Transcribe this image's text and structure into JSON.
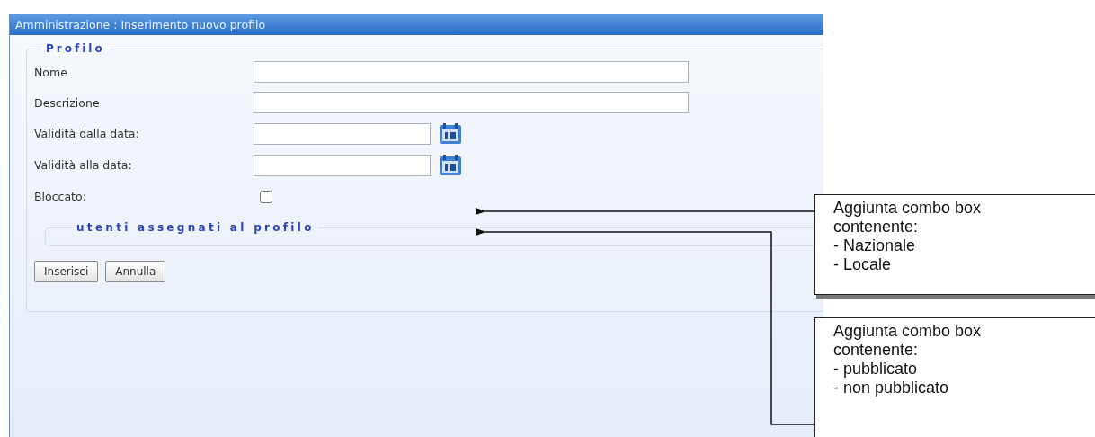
{
  "window": {
    "title": "Amministrazione : Inserimento nuovo profilo"
  },
  "profile": {
    "legend": "Profilo",
    "fields": [
      {
        "kind": "text",
        "label": "Nome"
      },
      {
        "kind": "text",
        "label": "Descrizione"
      },
      {
        "kind": "date",
        "label": "Validità dalla data:"
      },
      {
        "kind": "date",
        "label": "Validità alla data:"
      },
      {
        "kind": "checkbox",
        "label": "Bloccato:",
        "checked": false
      }
    ],
    "users_section": {
      "legend": "utenti assegnati al profilo"
    },
    "buttons": [
      "Inserisci",
      "Annulla"
    ]
  },
  "annotations": [
    {
      "text": "Aggiunta combo box contenente:",
      "items": [
        "- Nazionale",
        "- Locale"
      ]
    },
    {
      "text": "Aggiunta combo box contenente:",
      "items": [
        "- pubblicato",
        "- non pubblicato"
      ]
    }
  ]
}
